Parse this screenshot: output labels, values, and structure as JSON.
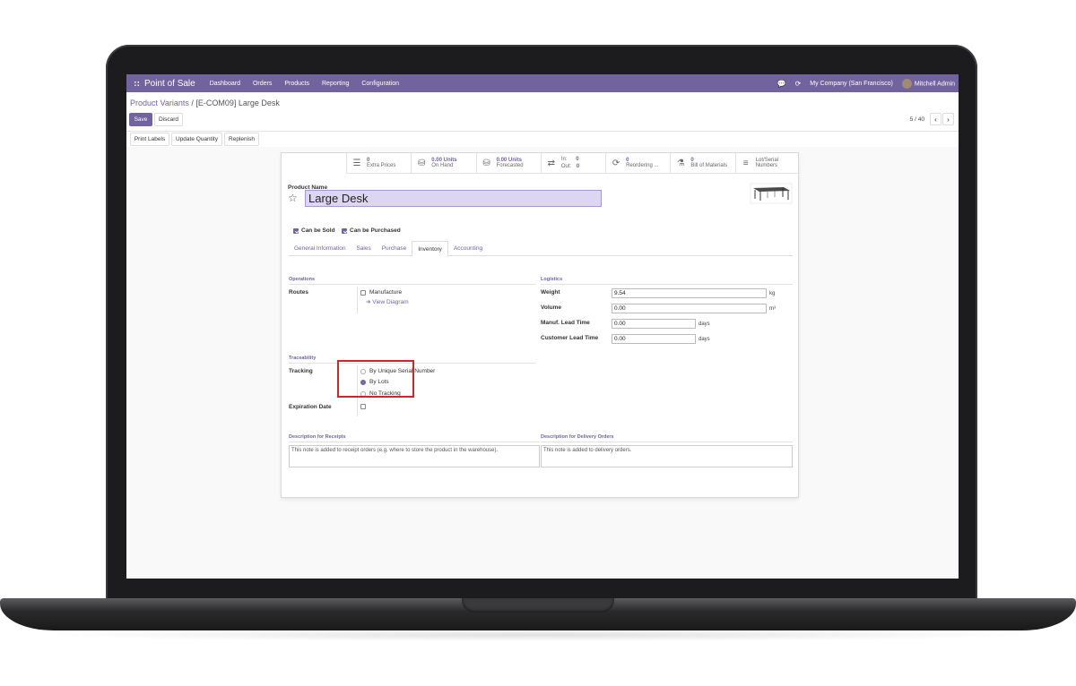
{
  "navbar": {
    "brand": "Point of Sale",
    "menu": [
      "Dashboard",
      "Orders",
      "Products",
      "Reporting",
      "Configuration"
    ],
    "company": "My Company (San Francisco)",
    "user": "Mitchell Admin"
  },
  "breadcrumb": {
    "parent": "Product Variants",
    "separator": " / ",
    "current": "[E-COM09] Large Desk"
  },
  "toolbar": {
    "save": "Save",
    "discard": "Discard",
    "pager": "5 / 40"
  },
  "actions": [
    "Print Labels",
    "Update Quantity",
    "Replenish"
  ],
  "smart_buttons": [
    {
      "value": "0",
      "label": "Extra Prices",
      "icon": "list-icon"
    },
    {
      "value": "0.00 Units",
      "label": "On Hand",
      "icon": "cubes-icon"
    },
    {
      "value": "0.00 Units",
      "label": "Forecasted",
      "icon": "cubes-icon"
    },
    {
      "value": "",
      "label": "",
      "in_label": "In:",
      "in_value": "0",
      "out_label": "Out:",
      "out_value": "0",
      "icon": "exchange-icon"
    },
    {
      "value": "0",
      "label": "Reordering ...",
      "icon": "refresh-icon"
    },
    {
      "value": "0",
      "label": "Bill of Materials",
      "icon": "flask-icon"
    },
    {
      "value": "Lot/Serial",
      "label": "Numbers",
      "icon": "bars-icon"
    }
  ],
  "product": {
    "name_label": "Product Name",
    "name": "Large Desk",
    "can_be_sold": "Can be Sold",
    "can_be_purchased": "Can be Purchased"
  },
  "tabs": [
    "General Information",
    "Sales",
    "Purchase",
    "Inventory",
    "Accounting"
  ],
  "operations": {
    "title": "Operations",
    "routes_label": "Routes",
    "manufacture": "Manufacture",
    "view_diagram": "View Diagram"
  },
  "logistics": {
    "title": "Logistics",
    "weight_label": "Weight",
    "weight": "9.54",
    "weight_unit": "kg",
    "volume_label": "Volume",
    "volume": "0.00",
    "volume_unit": "m³",
    "manuf_label": "Manuf. Lead Time",
    "manuf": "0.00",
    "manuf_unit": "days",
    "customer_label": "Customer Lead Time",
    "customer": "0.00",
    "customer_unit": "days"
  },
  "traceability": {
    "title": "Traceability",
    "tracking_label": "Tracking",
    "options": [
      "By Unique Serial Number",
      "By Lots",
      "No Tracking"
    ],
    "selected": "By Lots",
    "expiration_label": "Expiration Date"
  },
  "descriptions": {
    "receipts_title": "Description for Receipts",
    "receipts_placeholder": "This note is added to receipt orders (e.g. where to store the product in the warehouse).",
    "delivery_title": "Description for Delivery Orders",
    "delivery_placeholder": "This note is added to delivery orders."
  },
  "colors": {
    "accent": "#71639e",
    "highlight": "#c8282e"
  }
}
